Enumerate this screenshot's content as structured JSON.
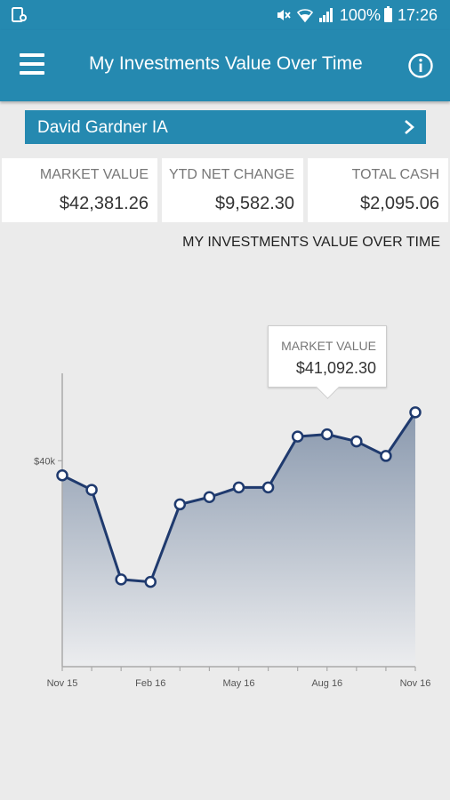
{
  "status_bar": {
    "battery": "100%",
    "time": "17:26",
    "icons": [
      "device-notification-icon",
      "mute-icon",
      "wifi-icon",
      "signal-icon",
      "battery-icon"
    ]
  },
  "app_bar": {
    "title": "My Investments Value Over Time",
    "menu_icon": "hamburger-menu-icon",
    "info_icon": "info-icon",
    "color": "#2589b0"
  },
  "account": {
    "name": "David Gardner IA",
    "icon": "chevron-right-icon"
  },
  "metrics": [
    {
      "label": "MARKET VALUE",
      "value": "$42,381.26"
    },
    {
      "label": "YTD NET CHANGE",
      "value": "$9,582.30"
    },
    {
      "label": "TOTAL CASH",
      "value": "$2,095.06"
    }
  ],
  "chart_title": "MY INVESTMENTS VALUE OVER TIME",
  "tooltip": {
    "label": "MARKET VALUE",
    "value": "$41,092.30"
  },
  "chart_data": {
    "type": "area",
    "title": "MY INVESTMENTS VALUE OVER TIME",
    "xlabel": "",
    "ylabel": "",
    "x_tick_labels": [
      "Nov 15",
      "Feb 16",
      "May 16",
      "Aug 16",
      "Nov 16"
    ],
    "y_tick_labels": [
      "$40k"
    ],
    "x": [
      "Nov 15",
      "Dec 15",
      "Jan 16",
      "Feb 16",
      "Mar 16",
      "Apr 16",
      "May 16",
      "Jun 16",
      "Jul 16",
      "Aug 16",
      "Sep 16",
      "Oct 16",
      "Nov 16"
    ],
    "values": [
      39400,
      38800,
      35100,
      35000,
      38200,
      38500,
      38900,
      38900,
      41000,
      41092.3,
      40800,
      40200,
      42000
    ],
    "ylim": [
      31500,
      43500
    ],
    "grid": false,
    "legend": "none",
    "line_color": "#1f3a6e",
    "fill_top_color": "#8a99ae",
    "fill_bottom_color": "#ecedef"
  }
}
